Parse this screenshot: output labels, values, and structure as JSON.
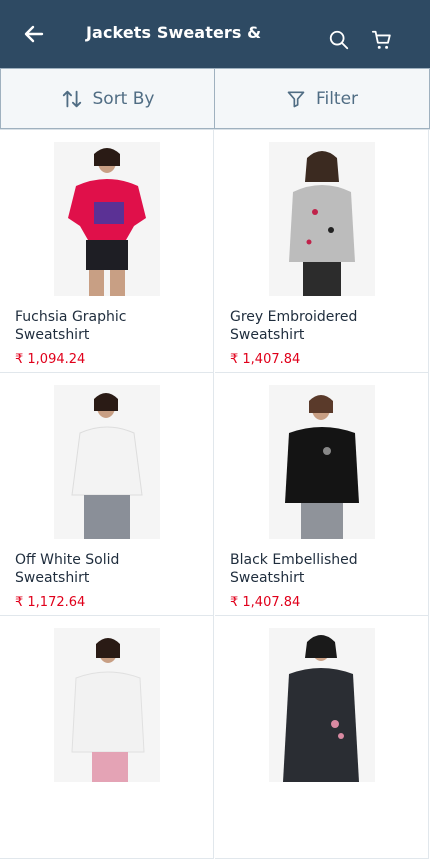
{
  "header": {
    "title": "Jackets Sweaters &",
    "icons": [
      "back-arrow-icon",
      "search-icon",
      "cart-icon"
    ]
  },
  "toolbar": {
    "sort_label": "Sort By",
    "filter_label": "Filter"
  },
  "products": [
    {
      "name_line1": "Fuchsia Graphic",
      "name_line2": "Sweatshirt",
      "price": "₹ 1,094.24"
    },
    {
      "name_line1": "Grey Embroidered",
      "name_line2": "Sweatshirt",
      "price": "₹ 1,407.84"
    },
    {
      "name_line1": "Off White Solid",
      "name_line2": "Sweatshirt",
      "price": "₹ 1,172.64"
    },
    {
      "name_line1": "Black Embellished",
      "name_line2": "Sweatshirt",
      "price": "₹ 1,407.84"
    },
    {
      "name_line1": "",
      "name_line2": "",
      "price": ""
    },
    {
      "name_line1": "",
      "name_line2": "",
      "price": ""
    }
  ],
  "colors": {
    "header_bg": "#2e4a63",
    "price": "#e0001b",
    "toolbar_text": "#506d84"
  }
}
